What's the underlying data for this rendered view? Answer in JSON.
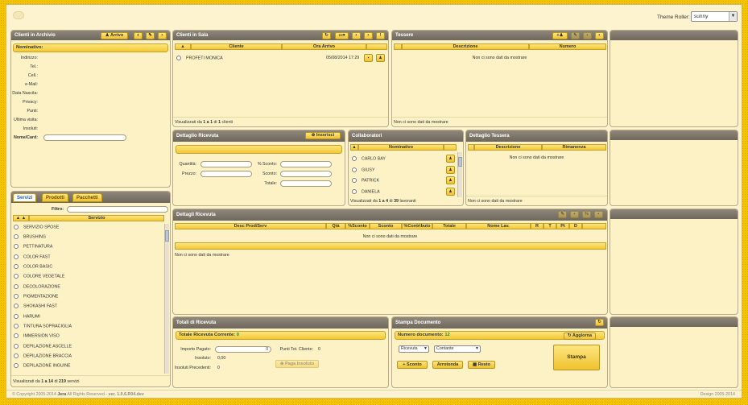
{
  "theme_roller": {
    "label": "Theme Roller:",
    "value": "sunny"
  },
  "clienti_archivio": {
    "title": "Clienti in Archivio",
    "arrivo_label": "Arrivo",
    "nominativo_label": "Nominativo:",
    "fields": [
      "Indirizzo:",
      "Tel.:",
      "Cell.:",
      "e-Mail:",
      "Data Nascita:",
      "Privacy:",
      "Punti:",
      "Ultima visita:",
      "Insoluti:",
      "Nome/Card:"
    ]
  },
  "servizi_panel": {
    "tabs": [
      "Servizi",
      "Prodotti",
      "Pacchetti"
    ],
    "filtro_label": "Filtro:",
    "col_servizio": "Servizio",
    "items": [
      "SERVIZIO SPOSE",
      "BRUSHING",
      "PETTINATURA",
      "COLOR FAST",
      "COLOR BASIC",
      "COLORE VEGETALE",
      "DECOLORAZIONE",
      "PIGMENTAZIONE",
      "SHOKASHI FAST",
      "HARUMI",
      "TINTURA SOPRACIGLIA",
      "IMMERSION VISO",
      "DEPILAZIONE ASCELLE",
      "DEPILAZIONE BRACCIA",
      "DEPILAZIONE INGUINE"
    ],
    "footer_prefix": "Visualizzati da ",
    "footer_range": "1 a 14",
    "footer_of": " di ",
    "footer_total": "219",
    "footer_suffix": " servizi"
  },
  "clienti_sala": {
    "title": "Clienti in Sala",
    "col_cliente": "Cliente",
    "col_ora": "Ora Arrivo",
    "rows": [
      {
        "cliente": "PROFETI MONICA",
        "ora": "05/08/2014 17:29"
      }
    ],
    "footer_prefix": "Visualizzati da ",
    "footer_range": "1 a 1",
    "footer_of": " di ",
    "footer_total": "1",
    "footer_suffix": " clienti"
  },
  "tessere": {
    "title": "Tessere",
    "col_descrizione": "Descrizione",
    "col_numero": "Numero",
    "empty": "Non ci sono dati da mostrare",
    "footer": "Non ci sono dati da mostrare"
  },
  "dettaglio_ricevuta": {
    "title": "Dettaglio Ricevuta",
    "inserisci_label": "Inserisci",
    "quantita_label": "Quantità:",
    "prezzo_label": "Prezzo:",
    "sconto_pct_label": "% Sconto:",
    "sconto_label": "Sconto:",
    "totale_label": "Totale:"
  },
  "collaboratori": {
    "title": "Collaboratori",
    "col_nominativo": "Nominativo",
    "items": [
      "CARLO BAY",
      "GIUSY",
      "PATRICK",
      "DANIELA"
    ],
    "footer_prefix": "Visualizzati da ",
    "footer_range": "1 a 4",
    "footer_of": " di ",
    "footer_total": "39",
    "footer_suffix": " lavoranti"
  },
  "dettaglio_tessera": {
    "title": "Dettaglio Tessera",
    "col_descrizione": "Descrizione",
    "col_rimanenza": "Rimanenza",
    "empty": "Non ci sono dati da mostrare",
    "footer": "Non ci sono dati da mostrare"
  },
  "dettagli_ricevuta": {
    "title": "Dettagli Ricevuta",
    "columns": [
      "Desc Prod/Serv",
      "Qtà",
      "%Sconto",
      "Sconto",
      "%Contributo",
      "Totale",
      "Nome Lav.",
      "R",
      "T",
      "Pt",
      "D"
    ],
    "empty": "Non ci sono dati da mostrare",
    "footer": "Non ci sono dati da mostrare"
  },
  "totali": {
    "title": "Totali di Ricevuta",
    "corrente_label": "Totale Ricevuta Corrente:",
    "corrente_value": "0",
    "importo_label": "Importo Pagato:",
    "importo_value": "0",
    "insoluto_label": "Insoluto:",
    "insoluto_value": "0,00",
    "precedenti_label": "Insoluti Precedenti:",
    "precedenti_value": "0",
    "punti_label": "Punti Tot. Cliente:",
    "punti_value": "0",
    "paga_label": "Paga Insoluto"
  },
  "stampa": {
    "title": "Stampa Documento",
    "numero_label": "Numero documento:",
    "numero_value": "12",
    "aggiorna_label": "Aggiorna",
    "tipo_value": "Ricevuta",
    "pagamento_value": "Contante",
    "sconto_label": "Sconto",
    "arrotonda_label": "Arrotonda",
    "resto_label": "Resto",
    "stampa_label": "Stampa"
  },
  "footer": {
    "copyright": "© Copyright 2005-2014 ",
    "brand": "Jera",
    "rights": " All Rights Reserved - ",
    "version": "ver. 1.0.6.R04.dev",
    "right": "Design 2005-2014"
  }
}
